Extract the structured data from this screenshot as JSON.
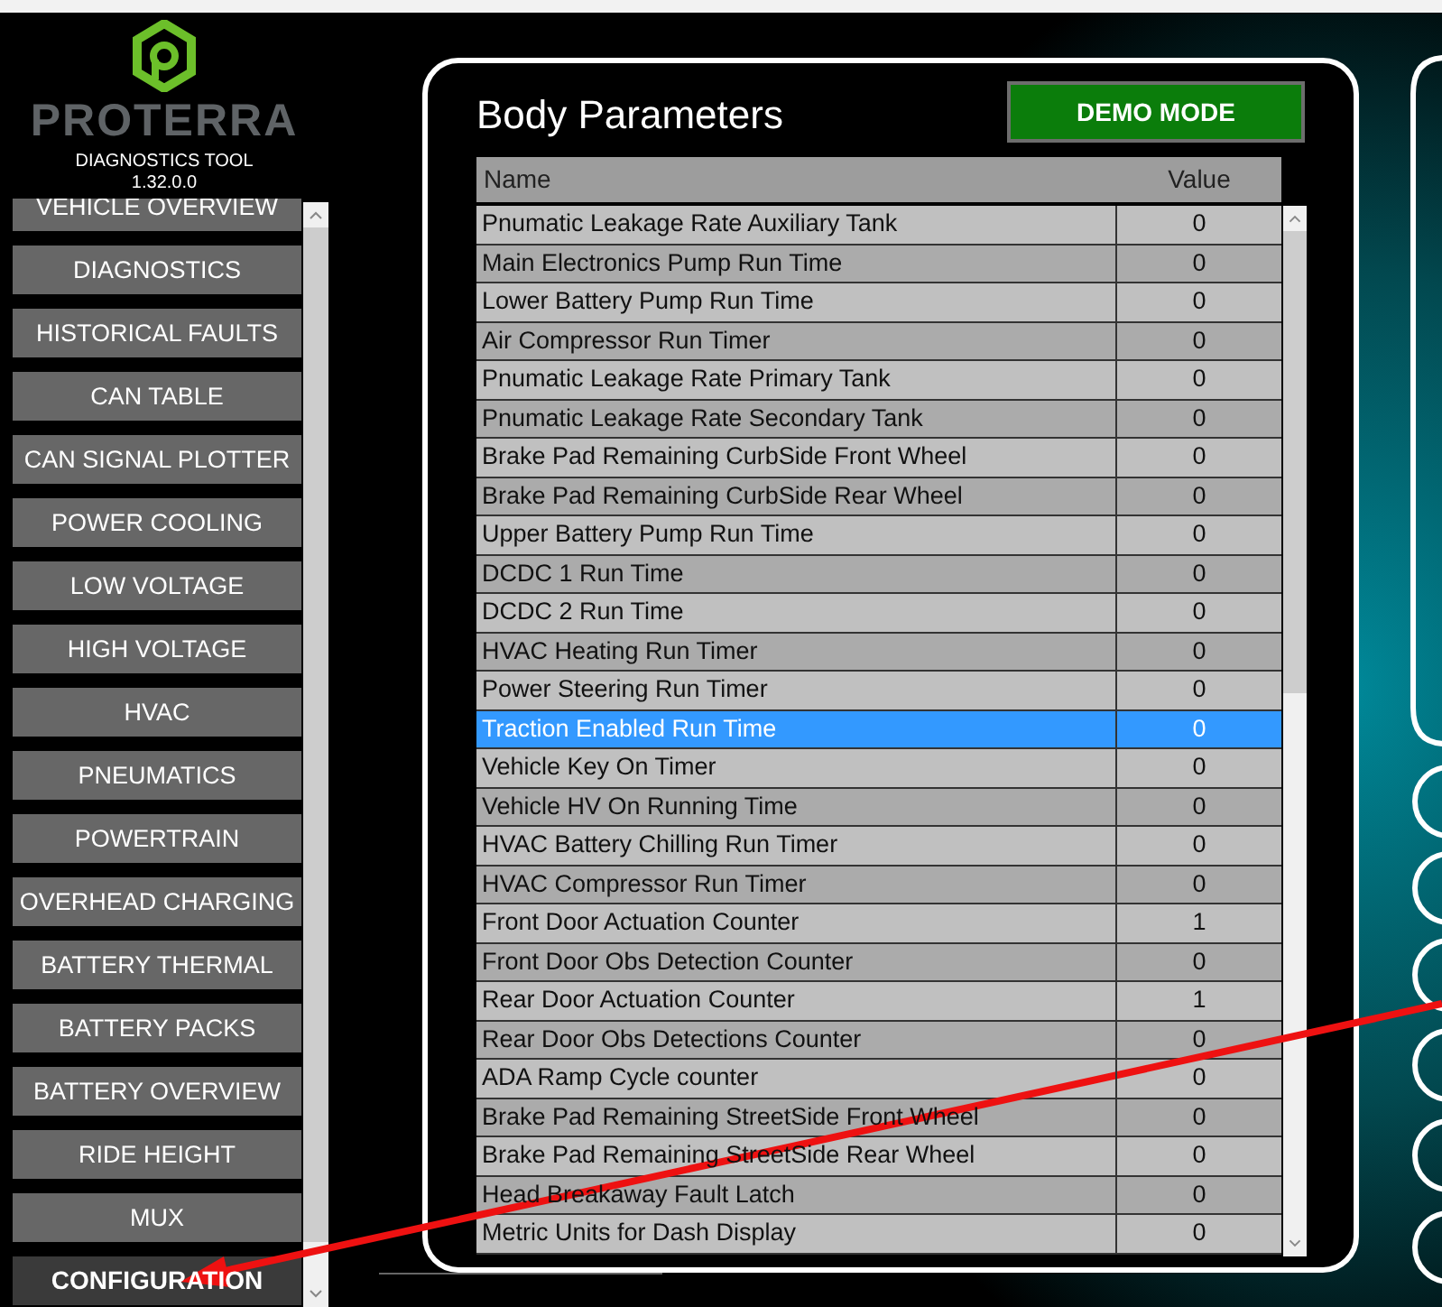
{
  "app": {
    "logo_text": "PROTERRA",
    "subtitle": "DIAGNOSTICS TOOL",
    "version": "1.32.0.0"
  },
  "sidebar": {
    "items": [
      {
        "label": "VEHICLE OVERVIEW",
        "selected": false
      },
      {
        "label": "DIAGNOSTICS",
        "selected": false
      },
      {
        "label": "HISTORICAL FAULTS",
        "selected": false
      },
      {
        "label": "CAN TABLE",
        "selected": false
      },
      {
        "label": "CAN SIGNAL PLOTTER",
        "selected": false
      },
      {
        "label": "POWER COOLING",
        "selected": false
      },
      {
        "label": "LOW VOLTAGE",
        "selected": false
      },
      {
        "label": "HIGH VOLTAGE",
        "selected": false
      },
      {
        "label": "HVAC",
        "selected": false
      },
      {
        "label": "PNEUMATICS",
        "selected": false
      },
      {
        "label": "POWERTRAIN",
        "selected": false
      },
      {
        "label": "OVERHEAD CHARGING",
        "selected": false
      },
      {
        "label": "BATTERY THERMAL",
        "selected": false
      },
      {
        "label": "BATTERY PACKS",
        "selected": false
      },
      {
        "label": "BATTERY OVERVIEW",
        "selected": false
      },
      {
        "label": "RIDE HEIGHT",
        "selected": false
      },
      {
        "label": "MUX",
        "selected": false
      },
      {
        "label": "CONFIGURATION",
        "selected": true
      }
    ]
  },
  "panel": {
    "title": "Body Parameters",
    "demo_button": "DEMO MODE",
    "table": {
      "columns": [
        "Name",
        "Value"
      ],
      "rows": [
        {
          "name": "Pnumatic Leakage Rate Auxiliary Tank",
          "value": "0",
          "selected": false
        },
        {
          "name": "Main Electronics Pump Run Time",
          "value": "0",
          "selected": false
        },
        {
          "name": "Lower Battery Pump Run Time",
          "value": "0",
          "selected": false
        },
        {
          "name": "Air Compressor Run Timer",
          "value": "0",
          "selected": false
        },
        {
          "name": "Pnumatic Leakage Rate Primary Tank",
          "value": "0",
          "selected": false
        },
        {
          "name": "Pnumatic Leakage Rate Secondary Tank",
          "value": "0",
          "selected": false
        },
        {
          "name": "Brake Pad Remaining CurbSide Front Wheel",
          "value": "0",
          "selected": false
        },
        {
          "name": "Brake Pad Remaining CurbSide Rear Wheel",
          "value": "0",
          "selected": false
        },
        {
          "name": "Upper Battery Pump Run Time",
          "value": "0",
          "selected": false
        },
        {
          "name": "DCDC 1 Run Time",
          "value": "0",
          "selected": false
        },
        {
          "name": "DCDC 2 Run Time",
          "value": "0",
          "selected": false
        },
        {
          "name": "HVAC Heating Run Timer",
          "value": "0",
          "selected": false
        },
        {
          "name": "Power Steering Run Timer",
          "value": "0",
          "selected": false
        },
        {
          "name": "Traction Enabled Run Time",
          "value": "0",
          "selected": true
        },
        {
          "name": "Vehicle Key On Timer",
          "value": "0",
          "selected": false
        },
        {
          "name": "Vehicle HV On Running Time",
          "value": "0",
          "selected": false
        },
        {
          "name": "HVAC Battery Chilling Run Timer",
          "value": "0",
          "selected": false
        },
        {
          "name": "HVAC Compressor Run Timer",
          "value": "0",
          "selected": false
        },
        {
          "name": "Front Door Actuation Counter",
          "value": "1",
          "selected": false
        },
        {
          "name": "Front Door Obs Detection Counter",
          "value": "0",
          "selected": false
        },
        {
          "name": "Rear Door Actuation Counter",
          "value": "1",
          "selected": false
        },
        {
          "name": "Rear Door Obs Detections Counter",
          "value": "0",
          "selected": false
        },
        {
          "name": "ADA Ramp Cycle counter",
          "value": "0",
          "selected": false
        },
        {
          "name": "Brake Pad Remaining StreetSide Front Wheel",
          "value": "0",
          "selected": false
        },
        {
          "name": "Brake Pad Remaining StreetSide Rear Wheel",
          "value": "0",
          "selected": false
        },
        {
          "name": "Head Breakaway Fault Latch",
          "value": "0",
          "selected": false
        },
        {
          "name": "Metric Units for Dash Display",
          "value": "0",
          "selected": false
        }
      ]
    }
  }
}
